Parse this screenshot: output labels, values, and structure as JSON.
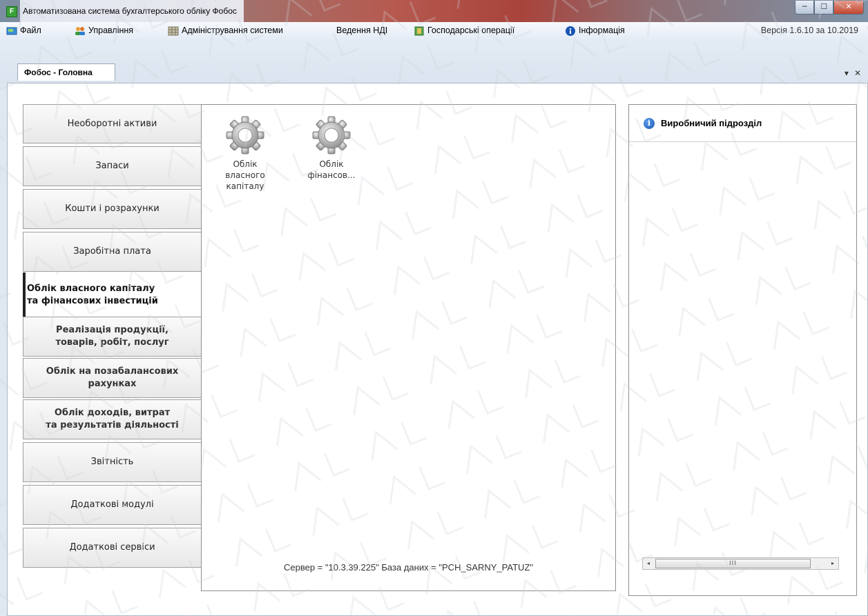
{
  "window": {
    "title": "Автоматизована система бухгалтерського обліку Фобос",
    "app_icon": "F",
    "minimize": "─",
    "maximize": "☐",
    "close": "✕"
  },
  "menu": {
    "items": [
      {
        "label": "Файл",
        "icon": "file-icon"
      },
      {
        "label": "Управління",
        "icon": "users-icon"
      },
      {
        "label": "Адміністрування системи",
        "icon": "grid-icon"
      },
      {
        "label": "Ведення НДІ",
        "icon": ""
      },
      {
        "label": "Господарські операції",
        "icon": "book-icon"
      },
      {
        "label": "Інформація",
        "icon": "info-icon"
      }
    ],
    "version": "Версія 1.6.10 за 10.2019"
  },
  "tabs": {
    "active_label": "Фобос - Головна",
    "dropdown": "▾",
    "close": "✕"
  },
  "nav": {
    "items": [
      {
        "label": "Необоротні активи"
      },
      {
        "label": "Запаси"
      },
      {
        "label": "Кошти і розрахунки"
      },
      {
        "label": "Заробітна плата"
      },
      {
        "label": "Облік власного капіталу\nта фінансових інвестицій"
      },
      {
        "label": "Реалізація продукції,\nтоварів, робіт, послуг"
      },
      {
        "label": "Облік на позабалансових\nрахунках"
      },
      {
        "label": "Облік доходів, витрат\nта результатів діяльності"
      },
      {
        "label": "Звітність"
      },
      {
        "label": "Додаткові модулі"
      },
      {
        "label": "Додаткові сервіси"
      }
    ]
  },
  "modules": [
    {
      "label": "Облік\nвласного\nкапіталу",
      "icon": "gear-icon"
    },
    {
      "label": "Облік\nфінансов...",
      "icon": "gear-icon"
    }
  ],
  "status": {
    "text": "Сервер = \"10.3.39.225\" База даних = \"PCH_SARNY_PATUZ\""
  },
  "right_panel": {
    "title": "Виробничий підрозділ",
    "scroll_left": "◂",
    "scroll_right": "▸",
    "scroll_grip": "III"
  },
  "colors": {
    "accent": "#1b56b5",
    "nav_border": "#9e9e9e",
    "active_marker": "#222222"
  }
}
